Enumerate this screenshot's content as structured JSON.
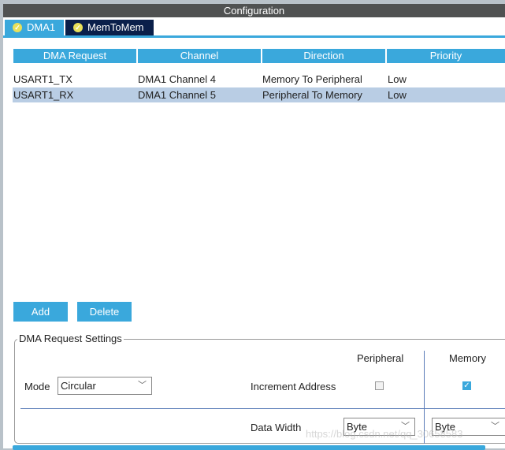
{
  "title": "Configuration",
  "tabs": [
    {
      "label": "DMA1",
      "icon": "check-circle-icon",
      "active": true
    },
    {
      "label": "MemToMem",
      "icon": "check-circle-icon",
      "active": false
    }
  ],
  "table": {
    "headers": [
      "DMA Request",
      "Channel",
      "Direction",
      "Priority"
    ],
    "rows": [
      [
        "USART1_TX",
        "DMA1 Channel 4",
        "Memory To Peripheral",
        "Low"
      ],
      [
        "USART1_RX",
        "DMA1 Channel 5",
        "Peripheral To Memory",
        "Low"
      ]
    ],
    "selected_row": 1
  },
  "buttons": {
    "add": "Add",
    "delete": "Delete"
  },
  "settings": {
    "legend": "DMA Request Settings",
    "mode_label": "Mode",
    "mode_value": "Circular",
    "peripheral_header": "Peripheral",
    "memory_header": "Memory",
    "increment_label": "Increment Address",
    "peripheral_increment": false,
    "memory_increment": true,
    "data_width_label": "Data Width",
    "peripheral_width": "Byte",
    "memory_width": "Byte"
  },
  "watermark": "https://blog.csdn.net/qq_30658583",
  "colors": {
    "accent": "#3aa8dc",
    "title_bar": "#505252",
    "selected_row": "#b9cde4",
    "active_tab_dark": "#0a1f4a"
  }
}
